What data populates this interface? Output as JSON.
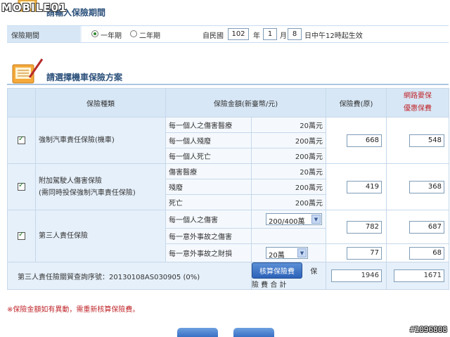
{
  "watermark": {
    "logo": "MOBILE01",
    "image_id": "#1096808"
  },
  "period_section": {
    "title": "請輸入保險期間",
    "label": "保險期間",
    "options": [
      "一年期",
      "二年期"
    ],
    "selected": "一年期",
    "date_prefix": "自民國",
    "year": "102",
    "year_unit": "年",
    "month": "1",
    "month_unit": "月",
    "day": "8",
    "day_suffix": "日中午12時起生效"
  },
  "plan_section": {
    "title": "請選擇機車保險方案",
    "headers": {
      "type": "保險種類",
      "amount": "保險金額(新臺幣/元)",
      "fee_original": "保險費(原)",
      "fee_online_line1": "網路要保",
      "fee_online_line2": "優惠保費"
    },
    "groups": [
      {
        "checked": true,
        "type_line1": "強制汽車責任保險(機車)",
        "type_line2": "",
        "items": [
          {
            "label": "每一個人之傷害醫療",
            "amount": "20萬元"
          },
          {
            "label": "每一個人殘廢",
            "amount": "200萬元"
          },
          {
            "label": "每一個人死亡",
            "amount": "200萬元"
          }
        ],
        "fee_original": "668",
        "fee_online": "548"
      },
      {
        "checked": true,
        "type_line1": "附加駕駛人傷害保險",
        "type_line2": "(需同時投保強制汽車責任保險)",
        "items": [
          {
            "label": "傷害醫療",
            "amount": "20萬元"
          },
          {
            "label": "殘廢",
            "amount": "200萬元"
          },
          {
            "label": "死亡",
            "amount": "200萬元"
          }
        ],
        "fee_original": "419",
        "fee_online": "368"
      },
      {
        "checked": true,
        "type_line1": "第三人責任保險",
        "type_line2": "",
        "items": [
          {
            "label": "每一個人之傷害",
            "select": "200/400萬"
          },
          {
            "label": "每一意外事故之傷害",
            "select": ""
          },
          {
            "label": "每一意外事故之財損",
            "select": "20萬"
          }
        ],
        "fee_original_1": "782",
        "fee_online_1": "687",
        "fee_original_2": "77",
        "fee_online_2": "68"
      }
    ],
    "summary": {
      "query_text": "第三人責任險關貿查詢序號：20130108AS030905 (0%)",
      "calc_button": "核算保險費",
      "total_label": "保 險 費 合 計",
      "total_original": "1946",
      "total_online": "1671"
    },
    "note": "※保險金額如有異動，需重新核算保險費。"
  },
  "colors": {
    "accent": "#2c62b8",
    "header_bg": "#d7e7f6",
    "warning": "#c0282d"
  }
}
